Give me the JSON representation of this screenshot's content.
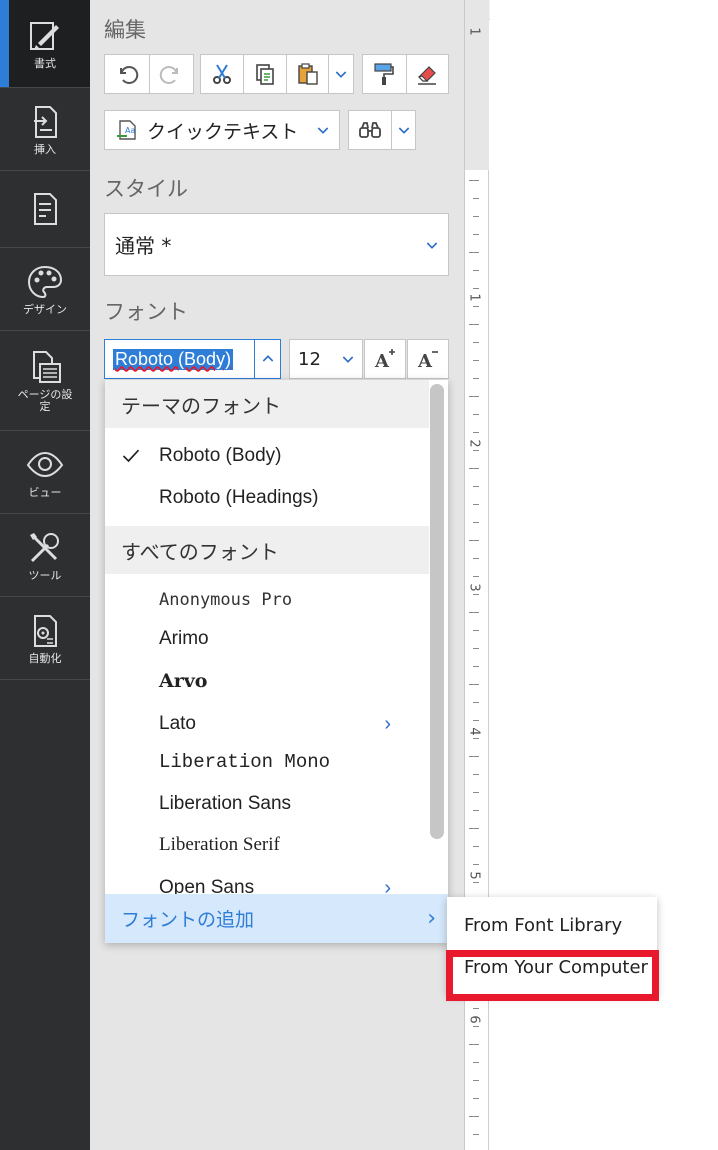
{
  "rail": {
    "items": [
      {
        "label": "書式",
        "icon": "format-brush-icon"
      },
      {
        "label": "挿入",
        "icon": "insert-icon"
      },
      {
        "label": "",
        "icon": "document-review-icon"
      },
      {
        "label": "デザイン",
        "icon": "palette-icon"
      },
      {
        "label": "ページの設定",
        "icon": "page-setup-icon"
      },
      {
        "label": "ビュー",
        "icon": "eye-icon"
      },
      {
        "label": "ツール",
        "icon": "tools-icon"
      },
      {
        "label": "自動化",
        "icon": "automation-icon"
      }
    ]
  },
  "panel": {
    "edit_title": "編集",
    "quick_text": "クイックテキスト",
    "style_title": "スタイル",
    "style_value": "通常 *",
    "font_title": "フォント",
    "font_value": "Roboto (Body)",
    "font_size": "12"
  },
  "font_menu": {
    "theme_group": "テーマのフォント",
    "theme_fonts": [
      "Roboto (Body)",
      "Roboto (Headings)"
    ],
    "selected_font": "Roboto (Body)",
    "all_group": "すべてのフォント",
    "all_fonts": [
      "Anonymous Pro",
      "Arimo",
      "Arvo",
      "Lato",
      "Liberation Mono",
      "Liberation Sans",
      "Liberation Serif",
      "Open Sans"
    ],
    "add_font": "フォントの追加"
  },
  "submenu": {
    "from_library": "From Font Library",
    "from_computer": "From Your Computer"
  },
  "ruler": {
    "numbers": [
      "1",
      "1",
      "2",
      "3",
      "4",
      "5",
      "6"
    ]
  },
  "colors": {
    "accent": "#2e7dd7",
    "highlight": "#e8192c",
    "rail": "#2d2f31"
  }
}
